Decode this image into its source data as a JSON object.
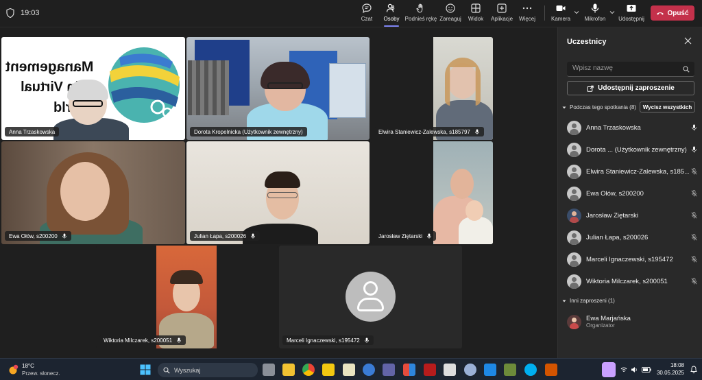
{
  "window": {
    "time": "19:03"
  },
  "toolbar": {
    "chat": "Czat",
    "people": "Osoby",
    "people_count": "8",
    "raise_hand": "Podnieś rękę",
    "react": "Zareaguj",
    "view": "Widok",
    "apps": "Aplikacje",
    "more": "Więcej",
    "camera": "Kamera",
    "mic": "Mikrofon",
    "share": "Udostępnij",
    "leave": "Opuść"
  },
  "accent": {
    "leave": "#c4314b",
    "active_tab": "#7f85f5"
  },
  "tiles": [
    {
      "name": "Anna Trzaskowska",
      "slide_lines": [
        "Management",
        "in Virtual",
        "World"
      ]
    },
    {
      "name": "Dorota Kropelnicka (Użytkownik zewnętrzny)"
    },
    {
      "name": "Elwira Staniewicz-Zalewska, s185797"
    },
    {
      "name": "Ewa Ołów, s200200"
    },
    {
      "name": "Julian Łapa, s200026"
    },
    {
      "name": "Jarosław Ziętarski"
    },
    {
      "name": "Wiktoria Milczarek, s200051"
    },
    {
      "name": "Marceli Ignaczewski, s195472"
    }
  ],
  "panel": {
    "title": "Uczestnicy",
    "search_placeholder": "Wpisz nazwę",
    "share_invite": "Udostępnij zaproszenie",
    "in_meeting": "Podczas tego spotkania (8)",
    "mute_all": "Wycisz wszystkich",
    "participants": [
      "Anna Trzaskowska",
      "Dorota ... (Użytkownik zewnętrzny)",
      "Elwira Staniewicz-Zalewska, s185...",
      "Ewa Ołów, s200200",
      "Jarosław Ziętarski",
      "Julian Łapa, s200026",
      "Marceli Ignaczewski, s195472",
      "Wiktoria Milczarek, s200051"
    ],
    "others": "Inni zaproszeni (1)",
    "invited": {
      "name": "Ewa Marjańska",
      "role": "Organizator"
    }
  },
  "taskbar": {
    "temp": "18°C",
    "weather": "Przew. słonecz.",
    "search": "Wyszukaj",
    "clock_time": "18:08",
    "clock_date": "30.05.2025"
  }
}
